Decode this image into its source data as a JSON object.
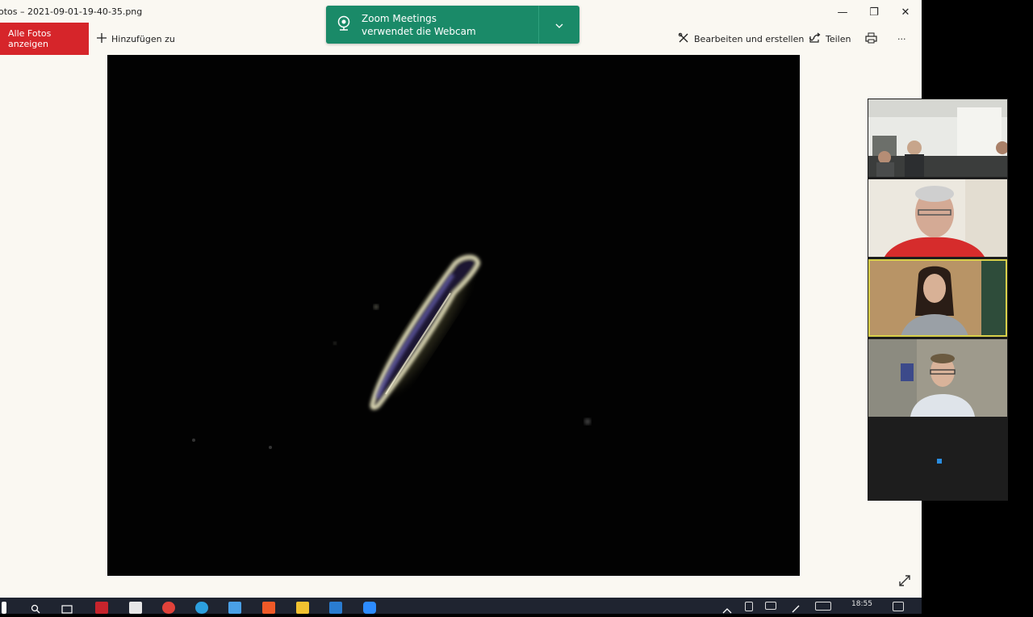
{
  "window": {
    "title": "otos – 2021-09-01-19-40-35.png",
    "minimize_glyph": "—",
    "restore_glyph": "❐",
    "close_glyph": "✕"
  },
  "toolbar": {
    "all_photos_label": "Alle Fotos anzeigen",
    "add_to_label": "Hinzufügen zu",
    "edit_create_label": "Bearbeiten und erstellen",
    "share_label": "Teilen",
    "print_icon": "printer-icon",
    "more_glyph": "···"
  },
  "notification": {
    "app_name": "Zoom Meetings",
    "message": "verwendet die Webcam",
    "icon": "webcam-icon"
  },
  "photo": {
    "description_icon": "microscope-image"
  },
  "zoom_gallery": {
    "participants": [
      {
        "icon": "video-tile-lab"
      },
      {
        "icon": "video-tile-man-glasses"
      },
      {
        "icon": "video-tile-woman",
        "active": true
      },
      {
        "icon": "video-tile-man-office"
      }
    ]
  },
  "taskbar": {
    "time": "18:55"
  }
}
